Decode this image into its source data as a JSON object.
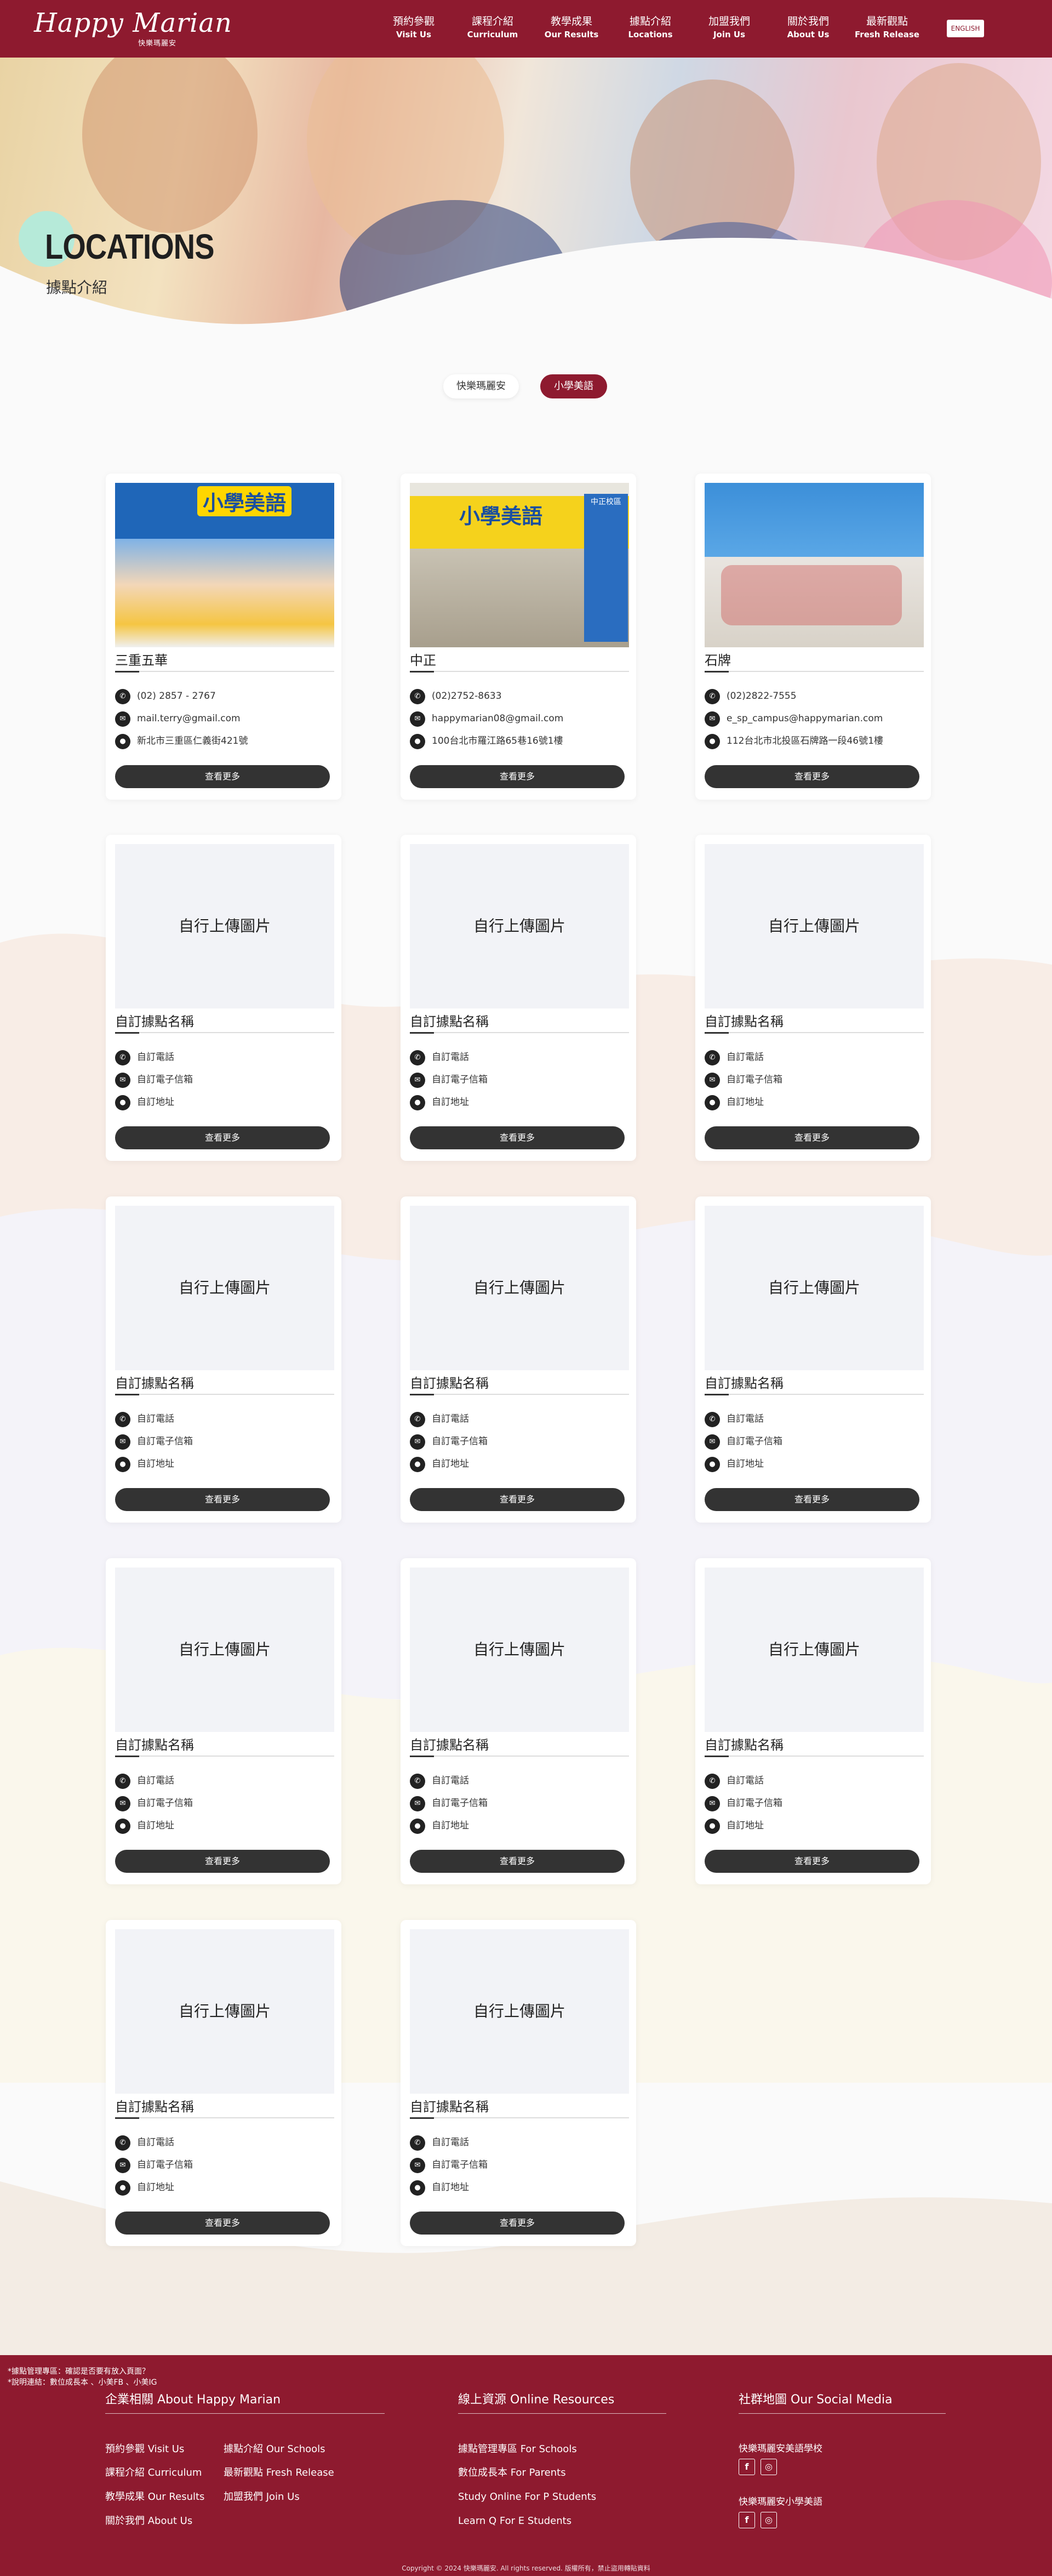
{
  "header": {
    "logo_script": "Happy Marian",
    "logo_sub": "快樂瑪麗安",
    "nav": [
      {
        "zh": "預約參觀",
        "en": "Visit Us"
      },
      {
        "zh": "課程介紹",
        "en": "Curriculum"
      },
      {
        "zh": "教學成果",
        "en": "Our Results"
      },
      {
        "zh": "據點介紹",
        "en": "Locations"
      },
      {
        "zh": "加盟我們",
        "en": "Join Us"
      },
      {
        "zh": "關於我們",
        "en": "About Us"
      },
      {
        "zh": "最新觀點",
        "en": "Fresh Release"
      }
    ],
    "lang_button": "ENGLISH"
  },
  "hero": {
    "title": "LOCATIONS",
    "subtitle": "據點介紹"
  },
  "tabs": [
    {
      "label": "快樂瑪麗安",
      "active": false
    },
    {
      "label": "小學美語",
      "active": true
    }
  ],
  "colors": {
    "brand": "#8e1a2f",
    "dark_button": "#333333",
    "placeholder_bg": "#f2f3f7"
  },
  "cards": [
    {
      "name": "三重五華",
      "phone": "(02) 2857 - 2767",
      "email": "mail.terry@gmail.com",
      "address": "新北市三重區仁義街421號",
      "image": "photo-classroom-kids",
      "image_banner": "小學美語",
      "button": "查看更多"
    },
    {
      "name": "中正",
      "phone": "(02)2752-8633",
      "email": "happymarian08@gmail.com",
      "address": "100台北市羅江路65巷16號1樓",
      "image": "photo-storefront",
      "image_banner": "小學美語",
      "image_side": "中正校區",
      "button": "查看更多"
    },
    {
      "name": "石牌",
      "phone": "(02)2822-7555",
      "email": "e_sp_campus@happymarian.com",
      "address": "112台北市北投區石牌路一段46號1樓",
      "image": "photo-classroom-desks",
      "button": "查看更多"
    },
    {
      "name": "自訂據點名稱",
      "phone": "自訂電話",
      "email": "自訂電子信箱",
      "address": "自訂地址",
      "placeholder": "自行上傳圖片",
      "button": "查看更多"
    },
    {
      "name": "自訂據點名稱",
      "phone": "自訂電話",
      "email": "自訂電子信箱",
      "address": "自訂地址",
      "placeholder": "自行上傳圖片",
      "button": "查看更多"
    },
    {
      "name": "自訂據點名稱",
      "phone": "自訂電話",
      "email": "自訂電子信箱",
      "address": "自訂地址",
      "placeholder": "自行上傳圖片",
      "button": "查看更多"
    },
    {
      "name": "自訂據點名稱",
      "phone": "自訂電話",
      "email": "自訂電子信箱",
      "address": "自訂地址",
      "placeholder": "自行上傳圖片",
      "button": "查看更多"
    },
    {
      "name": "自訂據點名稱",
      "phone": "自訂電話",
      "email": "自訂電子信箱",
      "address": "自訂地址",
      "placeholder": "自行上傳圖片",
      "button": "查看更多"
    },
    {
      "name": "自訂據點名稱",
      "phone": "自訂電話",
      "email": "自訂電子信箱",
      "address": "自訂地址",
      "placeholder": "自行上傳圖片",
      "button": "查看更多"
    },
    {
      "name": "自訂據點名稱",
      "phone": "自訂電話",
      "email": "自訂電子信箱",
      "address": "自訂地址",
      "placeholder": "自行上傳圖片",
      "button": "查看更多"
    },
    {
      "name": "自訂據點名稱",
      "phone": "自訂電話",
      "email": "自訂電子信箱",
      "address": "自訂地址",
      "placeholder": "自行上傳圖片",
      "button": "查看更多"
    },
    {
      "name": "自訂據點名稱",
      "phone": "自訂電話",
      "email": "自訂電子信箱",
      "address": "自訂地址",
      "placeholder": "自行上傳圖片",
      "button": "查看更多"
    },
    {
      "name": "自訂據點名稱",
      "phone": "自訂電話",
      "email": "自訂電子信箱",
      "address": "自訂地址",
      "placeholder": "自行上傳圖片",
      "button": "查看更多"
    },
    {
      "name": "自訂據點名稱",
      "phone": "自訂電話",
      "email": "自訂電子信箱",
      "address": "自訂地址",
      "placeholder": "自行上傳圖片",
      "button": "查看更多"
    }
  ],
  "footer": {
    "notes": [
      "*據點管理專區：確認是否要有放入頁面？",
      "*說明連結：數位成長本 、小美FB 、小美IG"
    ],
    "col1": {
      "title": "企業相關 About Happy Marian",
      "links": [
        "預約參觀  Visit Us",
        "據點介紹  Our Schools",
        "課程介紹  Curriculum",
        "最新觀點  Fresh Release",
        "教學成果  Our Results",
        "加盟我們  Join Us",
        "關於我們  About Us"
      ]
    },
    "col2": {
      "title": "線上資源 Online Resources",
      "links": [
        "據點管理專區  For Schools",
        "數位成長本  For Parents",
        "Study Online  For P Students",
        "Learn Q  For E Students"
      ]
    },
    "col3": {
      "title": "社群地圖 Our Social Media",
      "schools": [
        {
          "name": "快樂瑪麗安美語學校",
          "icons": [
            "facebook-icon",
            "instagram-icon"
          ]
        },
        {
          "name": "快樂瑪麗安小學美語",
          "icons": [
            "facebook-icon",
            "instagram-icon"
          ]
        }
      ]
    },
    "copyright": "Copyright © 2024 快樂瑪麗安. All rights reserved. 版權所有，禁止盜用轉貼資料"
  }
}
